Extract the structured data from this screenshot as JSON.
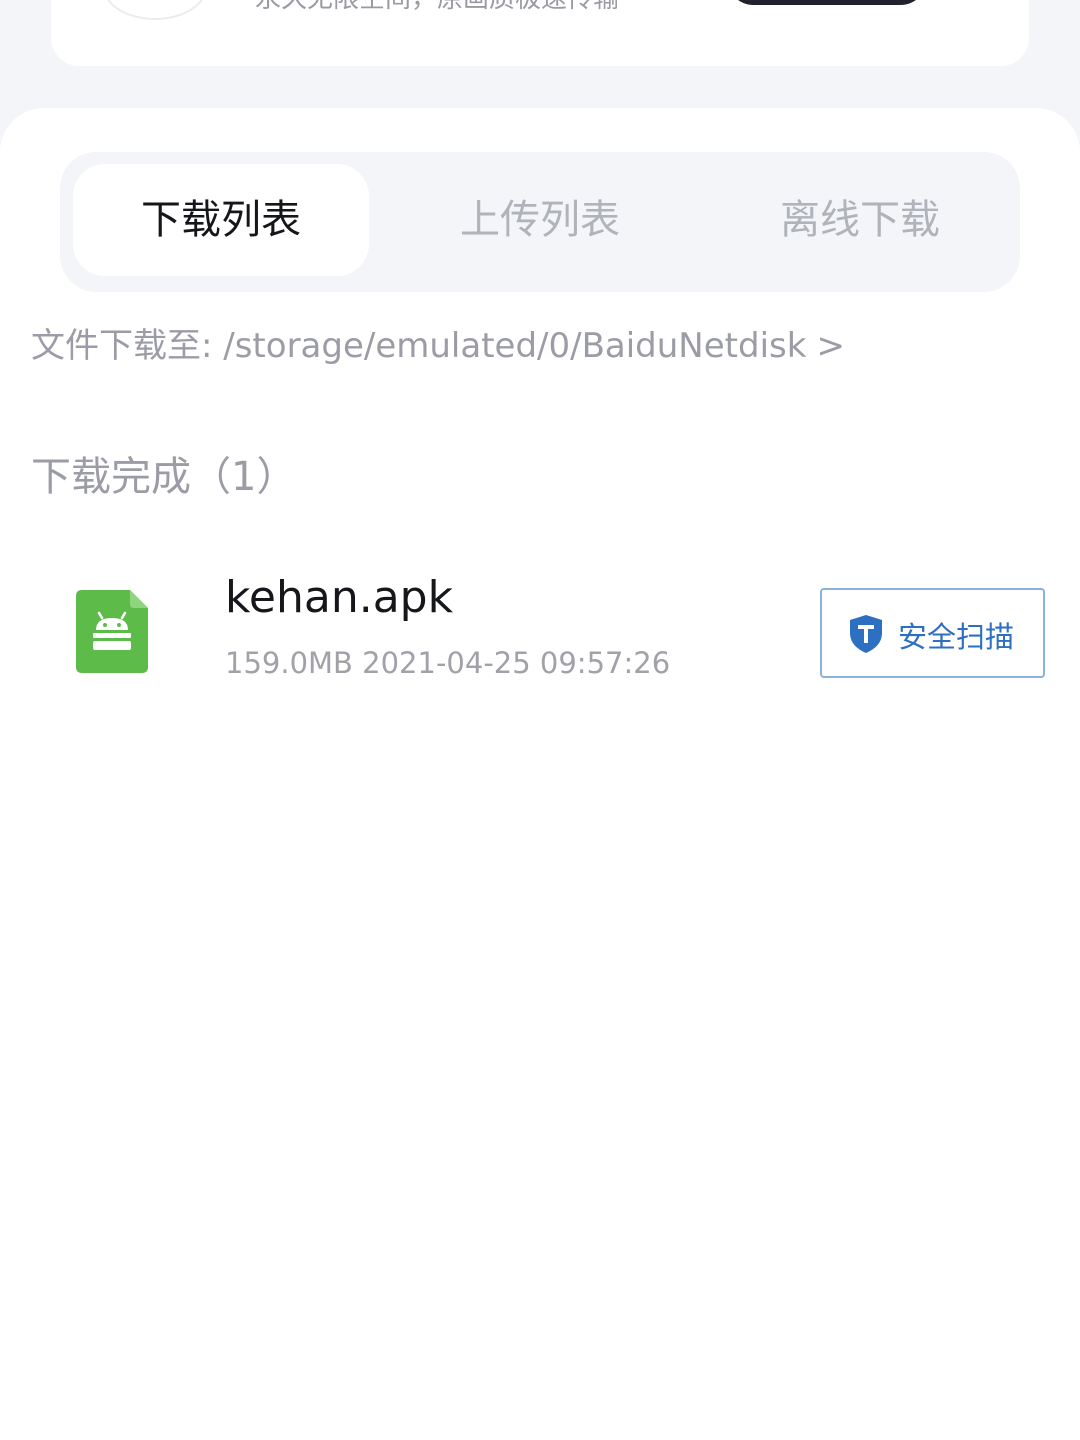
{
  "promo": {
    "text": "永久无限空间，原画质极速传输"
  },
  "tabs": [
    {
      "label": "下载列表",
      "active": true
    },
    {
      "label": "上传列表",
      "active": false
    },
    {
      "label": "离线下载",
      "active": false
    }
  ],
  "download_path": {
    "text": "文件下载至: /storage/emulated/0/BaiduNetdisk",
    "chevron": ">"
  },
  "section": {
    "title": "下载完成（1）"
  },
  "files": [
    {
      "name": "kehan.apk",
      "meta": "159.0MB 2021-04-25 09:57:26",
      "icon": "android-apk-icon",
      "action_label": "安全扫描",
      "action_icon": "shield-icon"
    }
  ],
  "colors": {
    "apk_green": "#5dbb4a",
    "scan_blue": "#2d6fc0",
    "active_tab_text": "#15161a",
    "inactive_tab_text": "#b1b3bb"
  }
}
